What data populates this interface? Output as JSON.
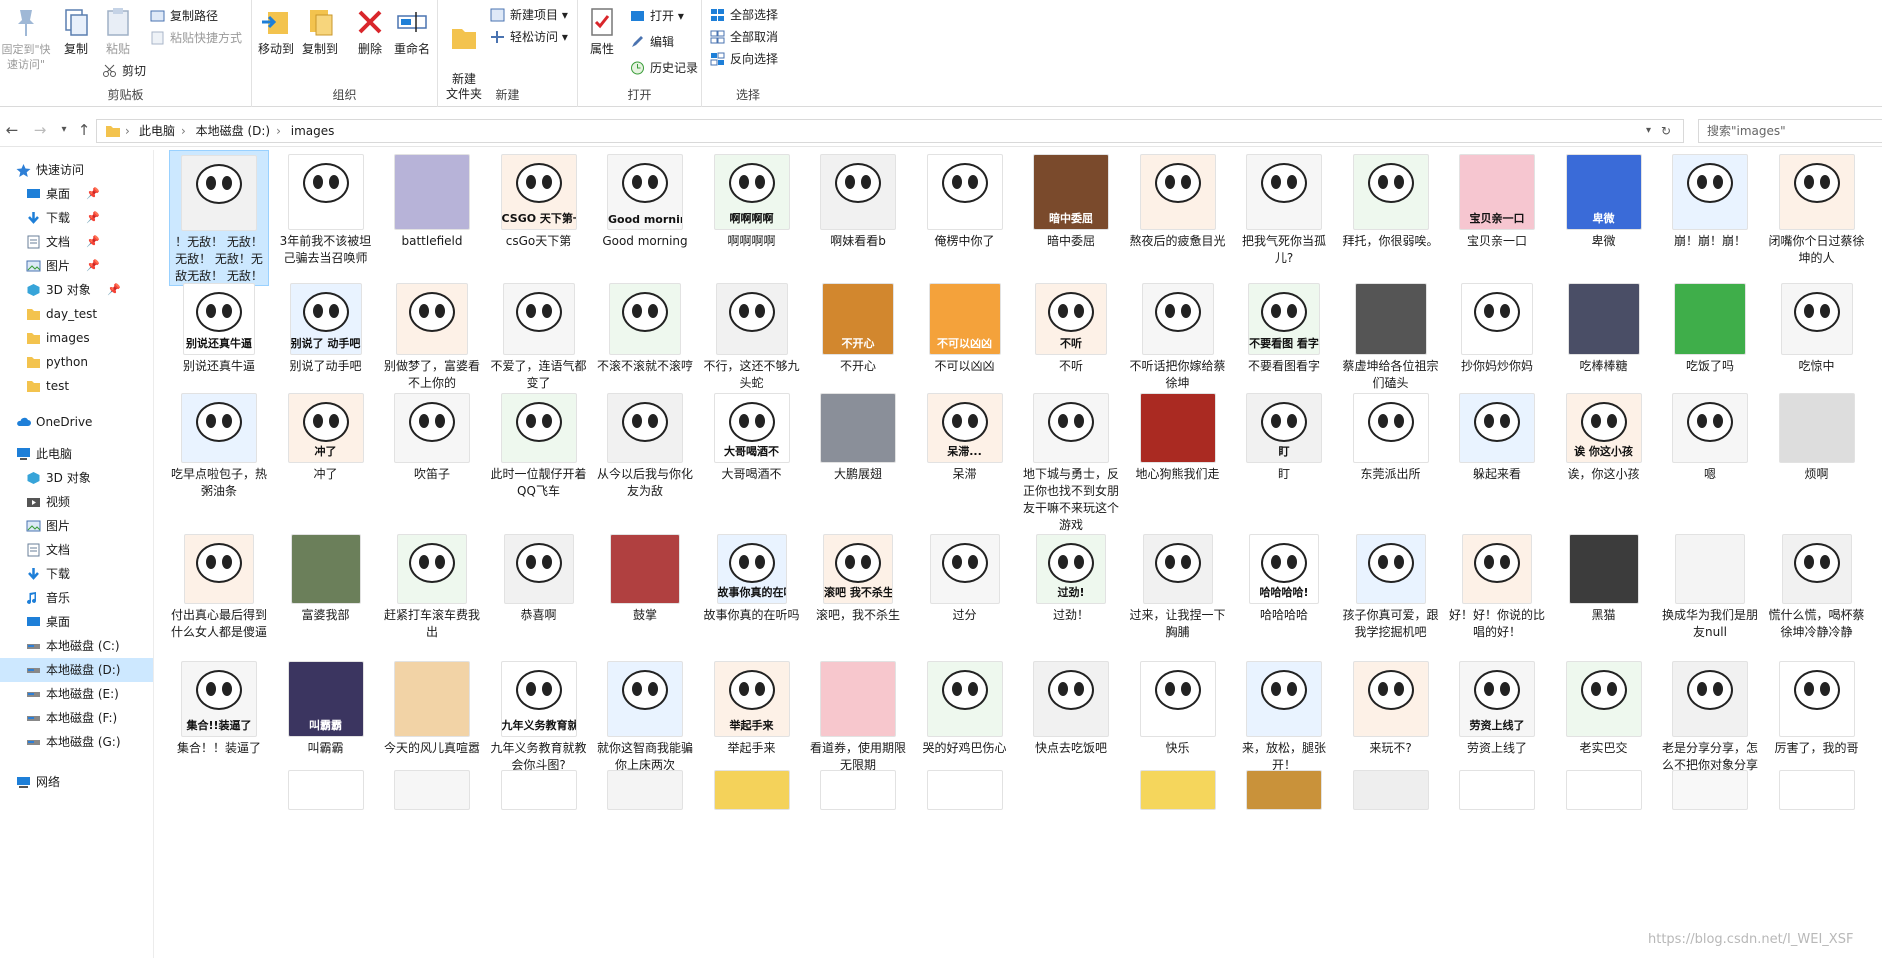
{
  "ribbon": {
    "clipboard": {
      "group_label": "剪贴板",
      "pin_label": "固定到\"快速访问\"",
      "copy_label": "复制",
      "paste_label": "粘贴",
      "copy_path_label": "复制路径",
      "paste_shortcut_label": "粘贴快捷方式",
      "cut_label": "剪切"
    },
    "organize": {
      "group_label": "组织",
      "move_to_label": "移动到",
      "copy_to_label": "复制到",
      "delete_label": "删除",
      "rename_label": "重命名"
    },
    "new": {
      "group_label": "新建",
      "new_folder_label": "新建\n文件夹",
      "new_item_label": "新建项目",
      "easy_access_label": "轻松访问"
    },
    "open": {
      "group_label": "打开",
      "properties_label": "属性",
      "open_label": "打开",
      "edit_label": "编辑",
      "history_label": "历史记录"
    },
    "select": {
      "group_label": "选择",
      "select_all_label": "全部选择",
      "select_none_label": "全部取消",
      "invert_label": "反向选择"
    }
  },
  "address": {
    "crumbs": [
      "此电脑",
      "本地磁盘 (D:)",
      "images"
    ],
    "search_placeholder": "搜索\"images\""
  },
  "nav": {
    "quick_access": "快速访问",
    "quick_items": [
      "桌面",
      "下载",
      "文档",
      "图片",
      "3D 对象",
      "day_test",
      "images",
      "python",
      "test"
    ],
    "onedrive": "OneDrive",
    "this_pc": "此电脑",
    "pc_items": [
      "3D 对象",
      "视频",
      "图片",
      "文档",
      "下载",
      "音乐",
      "桌面",
      "本地磁盘 (C:)",
      "本地磁盘 (D:)",
      "本地磁盘 (E:)",
      "本地磁盘 (F:)",
      "本地磁盘 (G:)"
    ],
    "network": "网络"
  },
  "files": [
    [
      "！无敌！ 无敌！无敌！ 无敌！无敌无敌！ 无敌！",
      "3年前我不该被坦己骗去当召唤师",
      "battlefield",
      "csGo天下第",
      "Good morning",
      "啊啊啊啊",
      "啊妹看看b",
      "俺楞中你了",
      "暗中委屈",
      "熬夜后的疲惫目光",
      "把我气死你当孤儿?",
      "拜托，你很弱唉。",
      "宝贝亲一口",
      "卑微",
      "崩！崩！崩！",
      "闭嘴你个日过蔡徐坤的人"
    ],
    [
      "别说还真牛逼",
      "别说了动手吧",
      "别做梦了，富婆看不上你的",
      "不爱了，连语气都变了",
      "不滚不滚就不滚哼",
      "不行，这还不够九头蛇",
      "不开心",
      "不可以凶凶",
      "不听",
      "不听话把你嫁给蔡徐坤",
      "不要看图看字",
      "蔡虚坤给各位祖宗们磕头",
      "抄你妈炒你妈",
      "吃棒棒糖",
      "吃饭了吗",
      "吃惊中"
    ],
    [
      "吃早点啦包子，热粥油条",
      "冲了",
      "吹笛子",
      "此时一位靓仔开着QQ飞车",
      "从今以后我与你化友为敌",
      "大哥喝酒不",
      "大鹏展翅",
      "呆滞",
      "地下城与勇士，反正你也找不到女朋友干嘛不来玩这个游戏",
      "地心狗熊我们走",
      "盯",
      "东莞派出所",
      "躲起来看",
      "诶，你这小孩",
      "嗯",
      "烦啊"
    ],
    [
      "付出真心最后得到什么女人都是傻逼",
      "富婆我部",
      "赶紧打车滚车费我出",
      "恭喜啊",
      "鼓掌",
      "故事你真的在听吗",
      "滚吧，我不杀生",
      "过分",
      "过劲！",
      "过来，让我捏一下胸脯",
      "哈哈哈哈",
      "孩子你真可爱，跟我学挖掘机吧",
      "好！好！你说的比唱的好！",
      "黑猫",
      "换成华为我们是朋友null",
      "慌什么慌，喝杯蔡徐坤冷静冷静"
    ],
    [
      "集合！！装逼了",
      "叫霸霸",
      "今天的风儿真喧嚣",
      "九年义务教育就教会你斗图?",
      "就你这智商我能骗你上床两次",
      "举起手来",
      "看道券，使用期限无限期",
      "哭的好鸡巴伤心",
      "快点去吃饭吧",
      "快乐",
      "来，放松，腿张开！",
      "来玩不?",
      "劳资上线了",
      "老实巴交",
      "老是分享分享，怎么不把你对象分享出来?",
      "厉害了，我的哥"
    ]
  ],
  "thumb_captions": {
    "0-3": "CSGO 天下第一",
    "0-4": "Good morning",
    "0-5": "啊啊啊啊",
    "0-8": "暗中委屈",
    "0-12": "宝贝亲一口",
    "0-13": "卑微",
    "1-0": "别说还真牛逼",
    "1-1": "别说了 动手吧",
    "1-6": "不开心",
    "1-7": "不可以凶凶",
    "1-8": "不听",
    "1-10": "不要看图 看字",
    "2-1": "冲了",
    "2-5": "大哥喝酒不",
    "2-7": "呆滞...",
    "2-10": "盯",
    "2-13": "诶 你这小孩",
    "3-5": "故事你真的在听",
    "3-6": "滚吧 我不杀生",
    "3-8": "过劲!",
    "3-10": "哈哈哈哈!",
    "4-0": "集合!!装逼了",
    "4-1": "叫霸霸",
    "4-3": "九年义务教育就教会你们斗图",
    "4-5": "举起手来",
    "4-12": "劳资上线了"
  },
  "watermark": "https://blog.csdn.net/I_WEI_XSF",
  "colors": {
    "selection": "#cde8ff",
    "accent_blue": "#1e7fd8",
    "folder_yellow": "#f3c34e",
    "delete_red": "#d9262b"
  }
}
